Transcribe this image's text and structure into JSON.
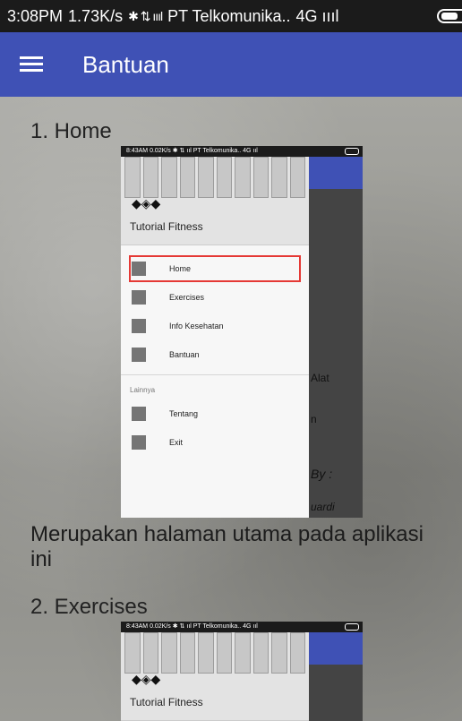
{
  "status_bar": {
    "time": "3:08PM",
    "speed": "1.73K/s",
    "indicators": "✱ ⇅ ıııl",
    "carrier": "PT Telkomunika..",
    "network": "4G ıııl"
  },
  "app_bar": {
    "title": "Bantuan"
  },
  "sections": [
    {
      "heading": "1. Home",
      "description": "Merupakan halaman utama pada aplikasi ini"
    },
    {
      "heading": "2. Exercises"
    }
  ],
  "screenshot1": {
    "status": "8:43AM 0.02K/s ✱ ⇅ ııl PT Telkomunika.. 4G ııl",
    "drawer_title": "Tutorial Fitness",
    "items": [
      "Home",
      "Exercises",
      "Info Kesehatan",
      "Bantuan"
    ],
    "subheader": "Lainnya",
    "other_items": [
      "Tentang",
      "Exit"
    ],
    "peek_text": [
      "Alat",
      "n",
      "By :",
      "uardi"
    ]
  },
  "screenshot2": {
    "status": "8:43AM 0.02K/s ✱ ⇅ ııl PT Telkomunika.. 4G ııl",
    "drawer_title": "Tutorial Fitness"
  },
  "colors": {
    "primary": "#3f51b5",
    "highlight": "#e53935"
  }
}
